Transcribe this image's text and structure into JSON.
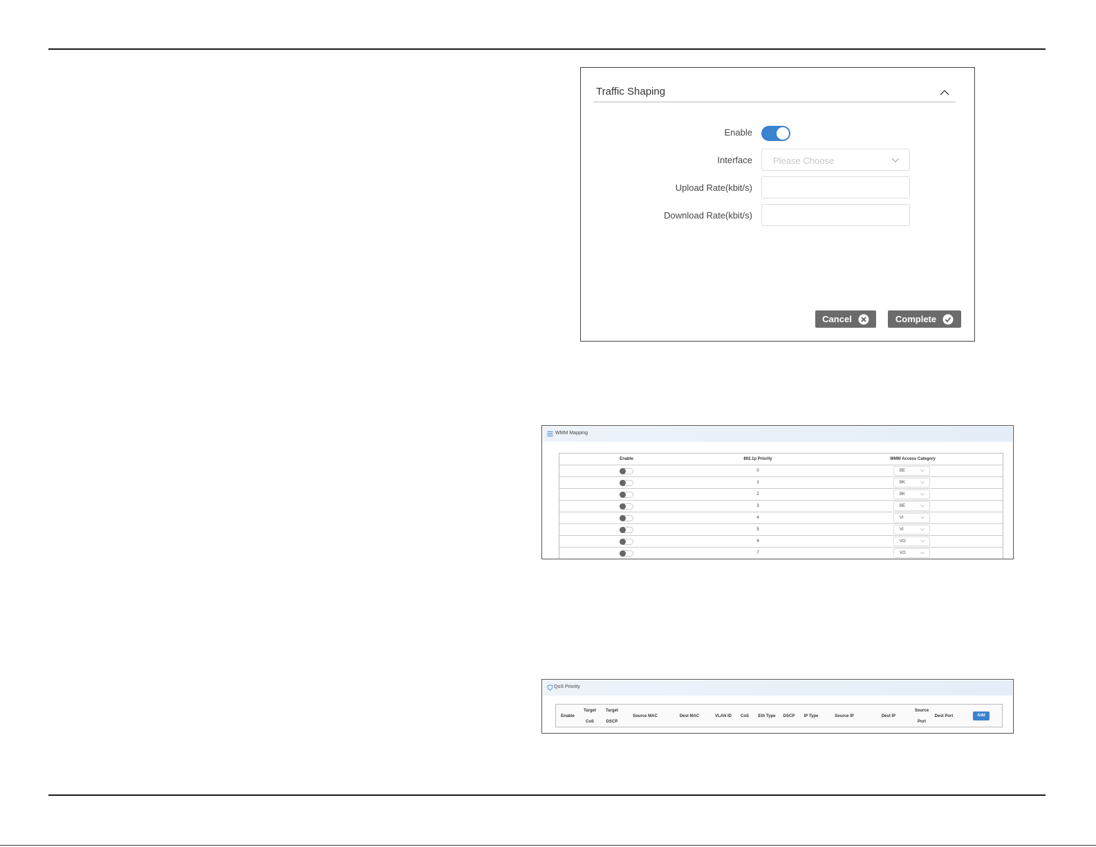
{
  "traffic_shaping": {
    "title": "Traffic Shaping",
    "enable_label": "Enable",
    "enabled": true,
    "interface_label": "Interface",
    "interface_placeholder": "Please Choose",
    "upload_label": "Upload Rate(kbit/s)",
    "upload_value": "",
    "download_label": "Download Rate(kbit/s)",
    "download_value": "",
    "cancel_label": "Cancel",
    "complete_label": "Complete",
    "colors": {
      "toggle_on": "#3b82cf",
      "button": "#6b6b6b"
    }
  },
  "wmm_mapping": {
    "title": "WMM Mapping",
    "headers": {
      "enable": "Enable",
      "priority": "802.1p Priority",
      "category": "WMM Access Category"
    },
    "rows": [
      {
        "enabled": false,
        "priority": "0",
        "category": "BE"
      },
      {
        "enabled": false,
        "priority": "1",
        "category": "BK"
      },
      {
        "enabled": false,
        "priority": "2",
        "category": "BK"
      },
      {
        "enabled": false,
        "priority": "3",
        "category": "BE"
      },
      {
        "enabled": false,
        "priority": "4",
        "category": "VI"
      },
      {
        "enabled": false,
        "priority": "5",
        "category": "VI"
      },
      {
        "enabled": false,
        "priority": "6",
        "category": "VO"
      },
      {
        "enabled": false,
        "priority": "7",
        "category": "VO"
      }
    ]
  },
  "qos_priority": {
    "title": "QoS Priority",
    "headers": {
      "enable": "Enable",
      "target_cos_1": "Target",
      "target_cos_2": "CoS",
      "target_dscp_1": "Target",
      "target_dscp_2": "DSCP",
      "source_mac": "Source MAC",
      "dest_mac": "Dest MAC",
      "vlan_id": "VLAN ID",
      "cos": "CoS",
      "eth_type": "Eth Type",
      "dscp": "DSCP",
      "ip_type": "IP Type",
      "source_ip": "Source IP",
      "dest_ip": "Dest IP",
      "source_port_1": "Source",
      "source_port_2": "Port",
      "dest_port": "Dest Port"
    },
    "add_label": "Add",
    "colors": {
      "add_button": "#3b82cf"
    }
  }
}
